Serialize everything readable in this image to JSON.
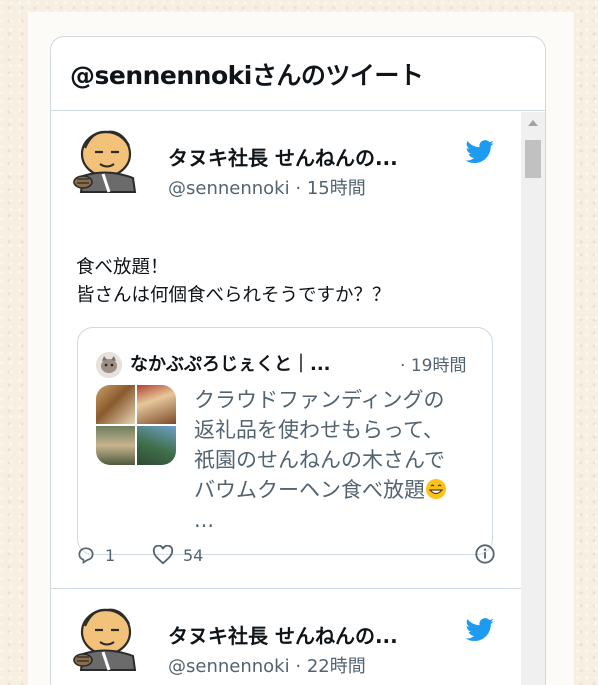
{
  "widget": {
    "title": "@sennennokiさんのツイート"
  },
  "tweets": [
    {
      "author_name": "タヌキ社長 せんねんの...",
      "handle": "@sennennoki",
      "separator": "·",
      "time": "15時間",
      "text_lines": [
        "食べ放題！",
        "皆さんは何個食べられそうですか？？"
      ],
      "quote": {
        "author_name": "なかぶぷろじぇくと｜...",
        "separator": "·",
        "time": "19時間",
        "text_lines": [
          "クラウドファンディングの",
          "返礼品を使わせもらって、",
          "祇園のせんねんの木さんで",
          "バウムクーヘン食べ放題",
          "..."
        ]
      },
      "reply_count": "1",
      "like_count": "54"
    },
    {
      "author_name": "タヌキ社長 せんねんの...",
      "handle": "@sennennoki",
      "separator": "·",
      "time": "22時間"
    }
  ],
  "colors": {
    "twitter_blue": "#1d9bf0",
    "text_primary": "#0f1419",
    "text_secondary": "#536471",
    "border": "#cfd9de"
  },
  "icons": {
    "bird": "twitter-bird-icon",
    "reply": "reply-icon",
    "like": "heart-icon",
    "info": "info-icon",
    "emoji": "grinning-face-emoji"
  }
}
